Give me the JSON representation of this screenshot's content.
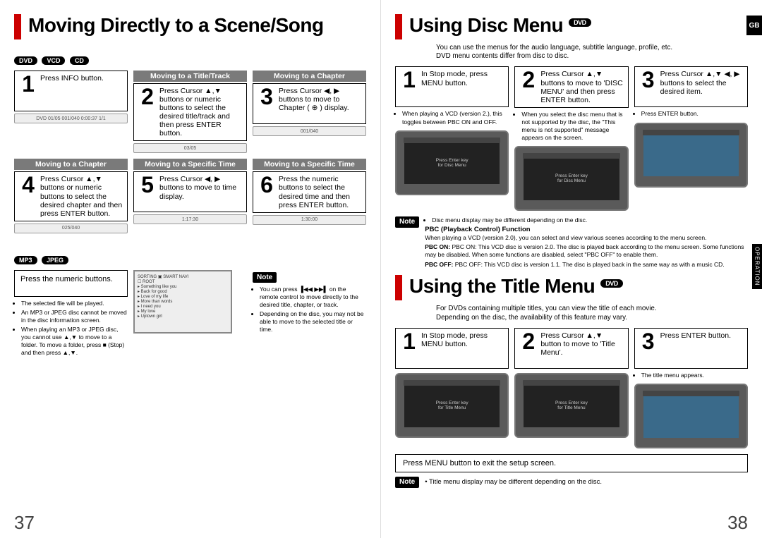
{
  "pages": {
    "left_num": "37",
    "right_num": "38"
  },
  "corner_tab": "GB",
  "side_tab": "OPERATION",
  "left": {
    "title": "Moving Directly to a Scene/Song",
    "badges_top": [
      "DVD",
      "VCD",
      "CD"
    ],
    "badges_mid": [
      "MP3",
      "JPEG"
    ],
    "note_label": "Note",
    "headers": {
      "h2": "Moving to a Title/Track",
      "h3": "Moving to a Chapter",
      "h4": "Moving to a Chapter",
      "h5": "Moving to a Specific Time",
      "h6": "Moving to a Specific Time"
    },
    "steps": {
      "s1": "Press INFO button.",
      "s2": "Press Cursor ▲,▼ buttons or numeric buttons to select the desired title/track and then press ENTER button.",
      "s3": "Press Cursor ◀, ▶ buttons to move to Chapter ( ⊕ ) display.",
      "s4": "Press Cursor ▲,▼ buttons or numeric buttons to select the desired chapter and then press ENTER button.",
      "s5": "Press Cursor ◀, ▶ buttons to move to time display.",
      "s6": "Press the numeric buttons to select the desired time and then press ENTER button.",
      "s7": "Press the numeric buttons."
    },
    "info_bars": {
      "i1": "DVD  01/05  001/040  0:00:37  1/1",
      "i2": "03/05",
      "i3": "001/040",
      "i4": "025/040",
      "i5": "1:17:30",
      "i6": "1:30:00"
    },
    "mp3_bullets": [
      "The selected file will be played.",
      "An MP3 or JPEG disc cannot be moved in the disc information screen.",
      "When playing an MP3 or JPEG disc, you cannot use ▲,▼ to move to a folder. To move a folder, press ■ (Stop) and then press ▲,▼."
    ],
    "note_bullets": [
      "You can press ▐◀◀ ▶▶▌ on the remote control to move directly to the desired title, chapter, or track.",
      "Depending on the disc, you may not be able to move to the selected title or time."
    ]
  },
  "right": {
    "title1": "Using Disc Menu",
    "title1_badge": "DVD",
    "intro1a": "You can use the menus for the audio language, subtitle language, profile, etc.",
    "intro1b": "DVD menu contents differ from disc to disc.",
    "steps1": {
      "s1": "In Stop mode, press MENU button.",
      "s2": "Press Cursor ▲,▼ buttons to move to 'DISC MENU' and then press ENTER button.",
      "s3": "Press Cursor ▲,▼ ◀, ▶ buttons to select the desired item."
    },
    "notes1": {
      "n1": "When playing a VCD (version 2.), this toggles between PBC ON and OFF.",
      "n2": "When you select the disc menu that is not supported by the disc, the \"This menu is not supported\" message appears on the screen.",
      "n3": "Press ENTER button."
    },
    "pbc_note_label": "Note",
    "pbc_bullets": [
      "Disc menu display may be different depending on the disc."
    ],
    "pbc_heading": "PBC (Playback Control) Function",
    "pbc_body": "When playing a VCD (version 2.0), you can select and view various scenes according to the menu screen.",
    "pbc_on": "PBC ON: This VCD disc is version 2.0. The disc is played back according to the menu screen. Some functions may be disabled. When some functions are disabled, select \"PBC OFF\" to enable them.",
    "pbc_off": "PBC OFF: This VCD disc is version 1.1. The disc is played back in the same way as with a music CD.",
    "title2": "Using the Title Menu",
    "title2_badge": "DVD",
    "intro2a": "For DVDs containing multiple titles, you can view the title of each movie.",
    "intro2b": "Depending on the disc, the availability of this feature may vary.",
    "steps2": {
      "s1": "In Stop mode, press MENU button.",
      "s2": "Press Cursor ▲,▼ button to move to 'Title Menu'.",
      "s3": "Press ENTER button."
    },
    "notes2": {
      "n3": "The title menu appears."
    },
    "exit_bar": "Press MENU button to exit the setup screen.",
    "bottom_note_label": "Note",
    "bottom_note": "Title menu display may be different depending on the disc."
  }
}
